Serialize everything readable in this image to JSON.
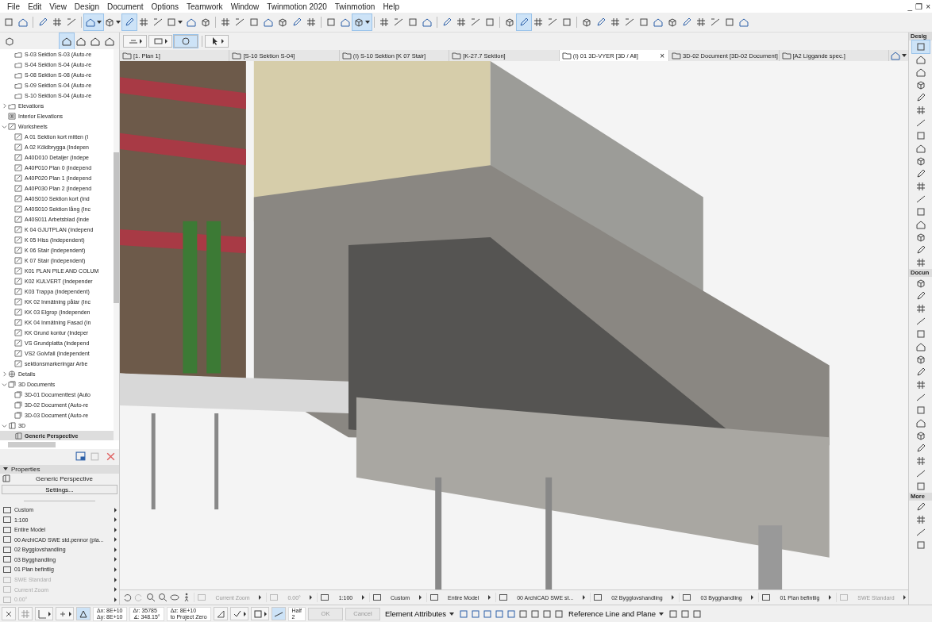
{
  "menu": [
    "File",
    "Edit",
    "View",
    "Design",
    "Document",
    "Options",
    "Teamwork",
    "Window",
    "Twinmotion 2020",
    "Twinmotion",
    "Help"
  ],
  "window_controls": [
    "_",
    "❐",
    "×"
  ],
  "toolbar": [
    {
      "kind": "button",
      "selected": false
    },
    {
      "kind": "button",
      "selected": false
    },
    {
      "kind": "separator"
    },
    {
      "kind": "button",
      "selected": false
    },
    {
      "kind": "button",
      "selected": false
    },
    {
      "kind": "button",
      "selected": false
    },
    {
      "kind": "separator"
    },
    {
      "kind": "dropdown",
      "selected": true
    },
    {
      "kind": "dropdown",
      "selected": false
    },
    {
      "kind": "button",
      "selected": true
    },
    {
      "kind": "button",
      "selected": false
    },
    {
      "kind": "button",
      "selected": false
    },
    {
      "kind": "dropdown",
      "selected": false
    },
    {
      "kind": "button",
      "selected": false
    },
    {
      "kind": "button",
      "selected": false
    },
    {
      "kind": "separator"
    },
    {
      "kind": "button",
      "selected": false
    },
    {
      "kind": "button",
      "selected": false
    },
    {
      "kind": "button",
      "selected": false
    },
    {
      "kind": "button",
      "selected": false
    },
    {
      "kind": "button",
      "selected": false
    },
    {
      "kind": "button",
      "selected": false
    },
    {
      "kind": "button",
      "selected": false
    },
    {
      "kind": "separator"
    },
    {
      "kind": "button",
      "selected": false
    },
    {
      "kind": "button",
      "selected": false
    },
    {
      "kind": "dropdown",
      "selected": true
    },
    {
      "kind": "separator"
    },
    {
      "kind": "button",
      "selected": false
    },
    {
      "kind": "button",
      "selected": false
    },
    {
      "kind": "button",
      "selected": false
    },
    {
      "kind": "button",
      "selected": false
    },
    {
      "kind": "separator"
    },
    {
      "kind": "button",
      "selected": false
    },
    {
      "kind": "button",
      "selected": false
    },
    {
      "kind": "button",
      "selected": false
    },
    {
      "kind": "button",
      "selected": false
    },
    {
      "kind": "separator"
    },
    {
      "kind": "button",
      "selected": false
    },
    {
      "kind": "button",
      "selected": true
    },
    {
      "kind": "button",
      "selected": false
    },
    {
      "kind": "button",
      "selected": false
    },
    {
      "kind": "button",
      "selected": false
    },
    {
      "kind": "separator"
    },
    {
      "kind": "button",
      "selected": false
    },
    {
      "kind": "button",
      "selected": false
    },
    {
      "kind": "button",
      "selected": false
    },
    {
      "kind": "button",
      "selected": false
    },
    {
      "kind": "button",
      "selected": false
    },
    {
      "kind": "button",
      "selected": false
    },
    {
      "kind": "button",
      "selected": false
    },
    {
      "kind": "button",
      "selected": false
    },
    {
      "kind": "button",
      "selected": false
    },
    {
      "kind": "button",
      "selected": false
    },
    {
      "kind": "button",
      "selected": false
    },
    {
      "kind": "button",
      "selected": false
    }
  ],
  "navigator_modes": [
    {
      "selected": true
    },
    {
      "selected": false
    },
    {
      "selected": false
    },
    {
      "selected": false
    }
  ],
  "tree": [
    {
      "children": [
        {
          "kind": "section",
          "label": "S-03 Sektion S-03 (Auto-re",
          "selected": false
        },
        {
          "kind": "section",
          "label": "S-04 Sektion S-04 (Auto-re",
          "selected": false
        },
        {
          "kind": "section",
          "label": "S-08 Sektion S-08 (Auto-re",
          "selected": false
        },
        {
          "kind": "section",
          "label": "S-09 Sektion S-04 (Auto-re",
          "selected": false
        },
        {
          "kind": "section",
          "label": "S-10 Sektion S-04 (Auto-re",
          "selected": false
        }
      ]
    },
    {
      "kind": "section",
      "label": "Elevations",
      "selected": false,
      "expanded": false
    },
    {
      "kind": "interior",
      "label": "Interior Elevations",
      "selected": false
    },
    {
      "kind": "worksheet",
      "label": "Worksheets",
      "selected": false,
      "expanded": true,
      "children": [
        {
          "kind": "worksheet",
          "label": "A 01 Sektion kort mitten (I",
          "selected": false
        },
        {
          "kind": "worksheet",
          "label": "A 02 Köldbrygga (Indepen",
          "selected": false
        },
        {
          "kind": "worksheet",
          "label": "A40D010 Detaljer (Indepe",
          "selected": false
        },
        {
          "kind": "worksheet",
          "label": "A40P010 Plan 0 (Independ",
          "selected": false
        },
        {
          "kind": "worksheet",
          "label": "A40P020 Plan 1 (Independ",
          "selected": false
        },
        {
          "kind": "worksheet",
          "label": "A40P030 Plan 2 (Independ",
          "selected": false
        },
        {
          "kind": "worksheet",
          "label": "A40S010 Sektion kort (Ind",
          "selected": false
        },
        {
          "kind": "worksheet",
          "label": "A40S010 Sektion lång (Inc",
          "selected": false
        },
        {
          "kind": "worksheet",
          "label": "A40S011 Arbetsblad (Inde",
          "selected": false
        },
        {
          "kind": "worksheet",
          "label": "K 04 GJUTPLAN (Independ",
          "selected": false
        },
        {
          "kind": "worksheet",
          "label": "K 05 Hiss (Independent)",
          "selected": false
        },
        {
          "kind": "worksheet",
          "label": "K 06 Stair (Independent)",
          "selected": false
        },
        {
          "kind": "worksheet",
          "label": "K 07 Stair (Independent)",
          "selected": false
        },
        {
          "kind": "worksheet",
          "label": "K01 PLAN PILE AND COLUM",
          "selected": false
        },
        {
          "kind": "worksheet",
          "label": "K02 KULVERT (Independer",
          "selected": false
        },
        {
          "kind": "worksheet",
          "label": "K03 Trappa (Independent)",
          "selected": false
        },
        {
          "kind": "worksheet",
          "label": "KK 02 Inmätning pålar (Inc",
          "selected": false
        },
        {
          "kind": "worksheet",
          "label": "KK 03 Elgrop (Independen",
          "selected": false
        },
        {
          "kind": "worksheet",
          "label": "KK 04 Inmätning Fasad (In",
          "selected": false
        },
        {
          "kind": "worksheet",
          "label": "KK Grund kontur (Indeper",
          "selected": false
        },
        {
          "kind": "worksheet",
          "label": "VS Grundplatta (Independ",
          "selected": false
        },
        {
          "kind": "worksheet",
          "label": "VS2 Golvfall (Independent",
          "selected": false
        },
        {
          "kind": "worksheet",
          "label": "sektionsmarkeringar Arbe",
          "selected": false
        }
      ]
    },
    {
      "kind": "detail",
      "label": "Details",
      "selected": false,
      "expanded": false
    },
    {
      "kind": "document3d",
      "label": "3D Documents",
      "selected": false,
      "expanded": true,
      "children": [
        {
          "kind": "document3d",
          "label": "3D-01 Documenttest (Auto",
          "selected": false
        },
        {
          "kind": "document3d",
          "label": "3D-02 Document (Auto-re",
          "selected": false
        },
        {
          "kind": "document3d",
          "label": "3D-03 Document (Auto-re",
          "selected": false
        }
      ]
    },
    {
      "kind": "view3d",
      "label": "3D",
      "selected": false,
      "expanded": true,
      "children": [
        {
          "kind": "view3d",
          "label": "Generic Perspective",
          "selected": true
        }
      ]
    }
  ],
  "properties": {
    "title": "Properties",
    "name": "Generic Perspective",
    "settings_button": "Settings...",
    "items": [
      {
        "label": "Custom",
        "disabled": false
      },
      {
        "label": "1:100",
        "disabled": false
      },
      {
        "label": "Entire Model",
        "disabled": false
      },
      {
        "label": "00 ArchiCAD SWE std.pennor (pla...",
        "disabled": false
      },
      {
        "label": "02 Bygglovshandling",
        "disabled": false
      },
      {
        "label": "03 Bygghandling",
        "disabled": false
      },
      {
        "label": "01 Plan befintlig",
        "disabled": false
      },
      {
        "label": "SWE Standard",
        "disabled": true
      },
      {
        "label": "Current Zoom",
        "disabled": true
      },
      {
        "label": "0.00°",
        "disabled": true
      }
    ]
  },
  "tabs": [
    {
      "label": "[1. Plan 1]",
      "selected": false
    },
    {
      "label": "[S-10 Sektion S-04]",
      "selected": false
    },
    {
      "label": "(I) S-10 Sektion  [K 07 Stair]",
      "selected": false
    },
    {
      "label": "[K-27.7 Sektion]",
      "selected": false
    },
    {
      "label": "(I) 01 3D-VYER [3D / All]",
      "selected": true
    },
    {
      "label": "3D-02 Document [3D-02 Document]",
      "selected": false
    },
    {
      "label": "[A2 Liggande spec.]",
      "selected": false
    }
  ],
  "tab_close": "×",
  "toolbox": [
    {
      "title": "Desig",
      "tools": [
        {
          "selected": true
        },
        {
          "selected": false
        }
      ]
    },
    {
      "tools": [
        {
          "selected": false
        },
        {
          "selected": false
        },
        {
          "selected": false
        },
        {
          "selected": false
        },
        {
          "selected": false
        },
        {
          "selected": false
        },
        {
          "selected": false
        },
        {
          "selected": false
        },
        {
          "selected": false
        },
        {
          "selected": false
        },
        {
          "selected": false
        },
        {
          "selected": false
        },
        {
          "selected": false
        },
        {
          "selected": false
        },
        {
          "selected": false
        },
        {
          "selected": false
        }
      ]
    },
    {
      "title": "Docun",
      "tools": [
        {
          "selected": false
        },
        {
          "selected": false
        },
        {
          "selected": false
        },
        {
          "selected": false
        },
        {
          "selected": false
        },
        {
          "selected": false
        },
        {
          "selected": false
        },
        {
          "selected": false
        },
        {
          "selected": false
        },
        {
          "selected": false
        },
        {
          "selected": false
        },
        {
          "selected": false
        },
        {
          "selected": false
        },
        {
          "selected": false
        },
        {
          "selected": false
        },
        {
          "selected": false
        },
        {
          "selected": false
        }
      ]
    },
    {
      "title": "More",
      "tools": [
        {
          "selected": false
        },
        {
          "selected": false
        },
        {
          "selected": false
        },
        {
          "selected": false
        }
      ]
    }
  ],
  "view_status": [
    {
      "label": "Current Zoom",
      "disabled": true
    },
    {
      "label": "0.00°",
      "disabled": true
    },
    {
      "label": "1:100",
      "disabled": false
    },
    {
      "label": "Custom",
      "disabled": false
    },
    {
      "label": "Entire Model",
      "disabled": false
    },
    {
      "label": "00 ArchiCAD SWE st...",
      "disabled": false
    },
    {
      "label": "02 Bygglovshandling",
      "disabled": false
    },
    {
      "label": "03 Bygghandling",
      "disabled": false
    },
    {
      "label": "01 Plan befintlig",
      "disabled": false
    },
    {
      "label": "SWE Standard",
      "disabled": true
    }
  ],
  "coordinates": [
    [
      "Δx: 8E+10",
      "Δy: 8E+10"
    ],
    [
      "Δr: 35785",
      "∡: 348.15°"
    ],
    [
      "Δz: 8E+10",
      "to Project Zero"
    ]
  ],
  "gravity": [
    "Half",
    "2"
  ],
  "ok_button": "OK",
  "cancel_button": "Cancel",
  "element_attributes": "Element Attributes",
  "reference_line": "Reference Line and Plane"
}
